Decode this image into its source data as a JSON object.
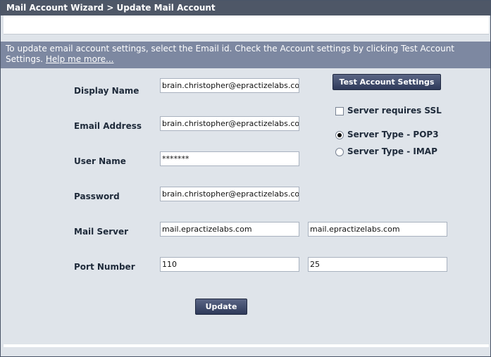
{
  "window": {
    "title": "Mail Account Wizard > Update Mail Account"
  },
  "info": {
    "text": "To update email account settings, select the Email id. Check the Account settings by clicking Test Account Settings.",
    "help_link": "Help me more..."
  },
  "form": {
    "display_name": {
      "label": "Display Name",
      "value": "brain.christopher@epractizelabs.com"
    },
    "email_address": {
      "label": "Email Address",
      "value": "brain.christopher@epractizelabs.com"
    },
    "user_name": {
      "label": "User Name",
      "value": "*******"
    },
    "password": {
      "label": "Password",
      "value": "brain.christopher@epractizelabs.com"
    },
    "mail_server": {
      "label": "Mail Server",
      "incoming": "mail.epractizelabs.com",
      "outgoing": "mail.epractizelabs.com"
    },
    "port_number": {
      "label": "Port Number",
      "incoming": "110",
      "outgoing": "25"
    }
  },
  "options": {
    "test_button": "Test Account Settings",
    "ssl": {
      "label": "Server requires SSL",
      "checked": false
    },
    "server_type": {
      "selected": "POP3",
      "pop3_label": "Server Type - POP3",
      "imap_label": "Server Type - IMAP"
    }
  },
  "actions": {
    "update_button": "Update"
  }
}
